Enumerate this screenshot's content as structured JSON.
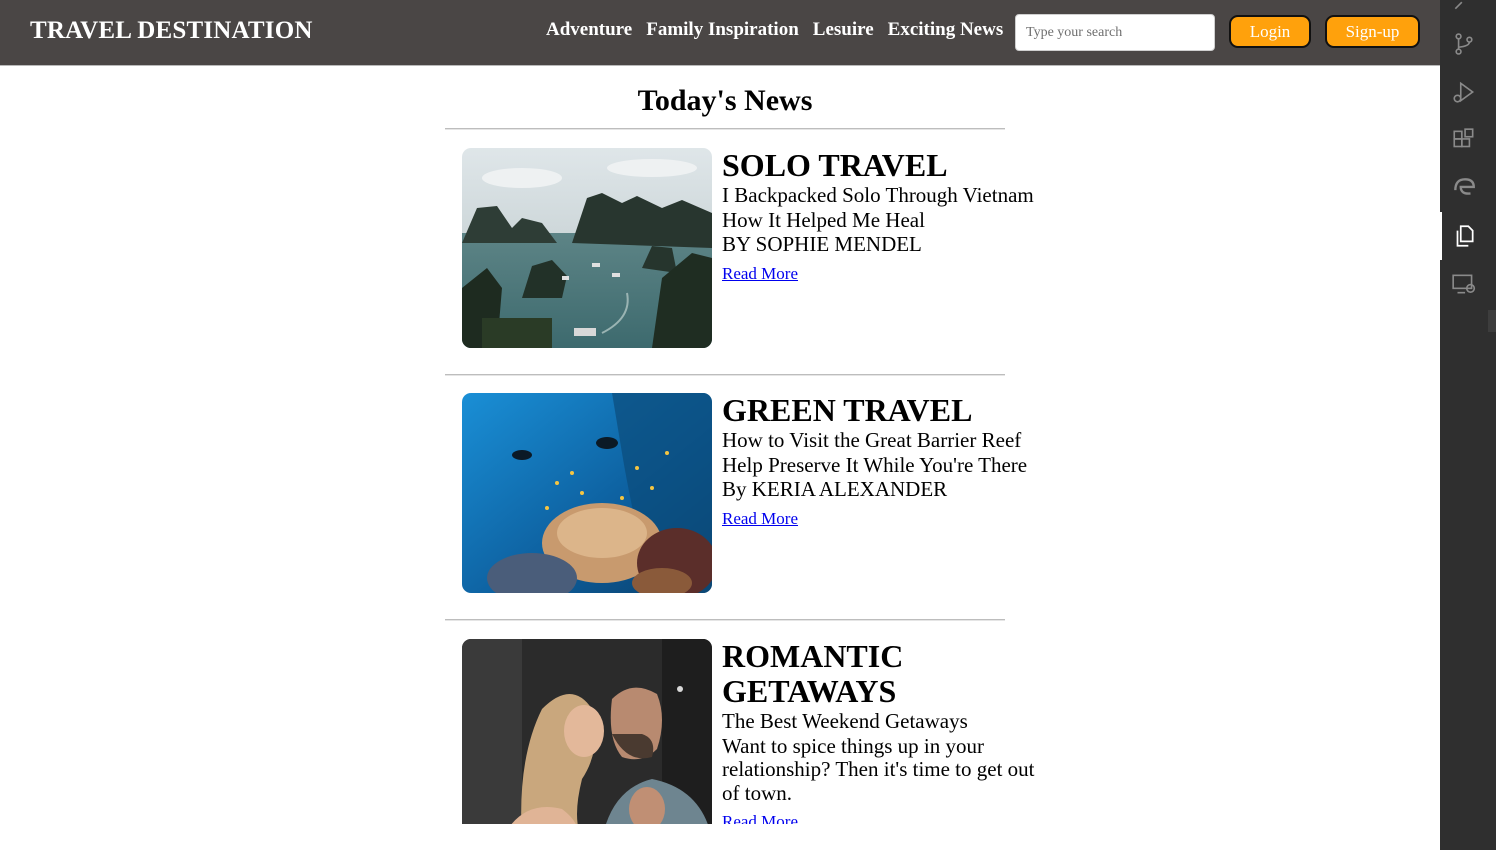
{
  "header": {
    "brand": "TRAVEL DESTINATION",
    "nav": [
      "Adventure",
      "Family Inspiration",
      "Lesuire",
      "Exciting News"
    ],
    "search_placeholder": "Type your search",
    "login_label": "Login",
    "signup_label": "Sign-up",
    "colors": {
      "bar": "#4a4645",
      "button": "#ffa10c"
    }
  },
  "main": {
    "title": "Today's News",
    "articles": [
      {
        "category": "SOLO TRAVEL",
        "lines": [
          "I Backpacked Solo Through Vietnam",
          "How It Helped Me Heal",
          "BY SOPHIE MENDEL"
        ],
        "link": "Read More",
        "image": "vietnam-bay-photo"
      },
      {
        "category": "GREEN TRAVEL",
        "lines": [
          "How to Visit the Great Barrier Reef",
          "Help Preserve It While You're There",
          "By KERIA ALEXANDER"
        ],
        "link": "Read More",
        "image": "coral-reef-photo"
      },
      {
        "category": "ROMANTIC GETAWAYS",
        "lines": [
          "The Best Weekend Getaways",
          "Want to spice things up in your relationship? Then it's time to get out of town."
        ],
        "link": "Read More",
        "image": "couple-kissing-photo"
      }
    ]
  },
  "sidebar": {
    "icons": [
      "source-control-icon",
      "run-debug-icon",
      "extensions-icon",
      "edge-icon",
      "explorer-icon",
      "remote-explorer-icon"
    ]
  }
}
